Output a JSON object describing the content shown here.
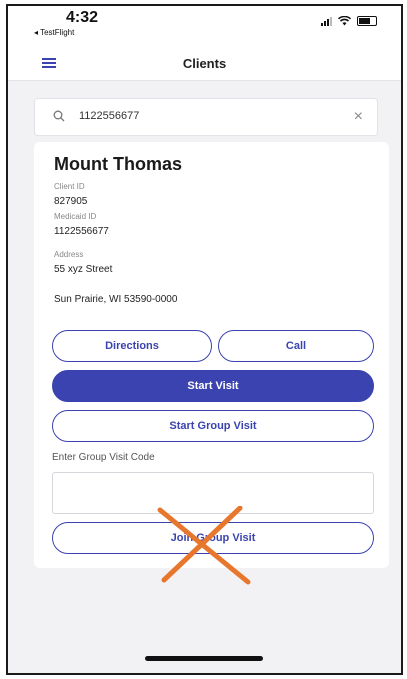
{
  "status_bar": {
    "time": "4:32",
    "back_app": "◂ TestFlight"
  },
  "header": {
    "title": "Clients"
  },
  "search": {
    "value": "1122556677"
  },
  "client": {
    "name": "Mount Thomas",
    "client_id_label": "Client ID",
    "client_id": "827905",
    "medicaid_id_label": "Medicaid ID",
    "medicaid_id": "1122556677",
    "address_label": "Address",
    "address_line1": "55 xyz Street",
    "address_line2": "Sun Prairie, WI 53590-0000"
  },
  "actions": {
    "directions_label": "Directions",
    "call_label": "Call",
    "start_visit_label": "Start Visit",
    "start_group_visit_label": "Start Group Visit",
    "group_code_label": "Enter Group Visit Code",
    "group_code_value": "",
    "join_group_visit_label": "Join Group Visit"
  },
  "colors": {
    "accent": "#3a43b0",
    "annotation": "#e8772e"
  }
}
